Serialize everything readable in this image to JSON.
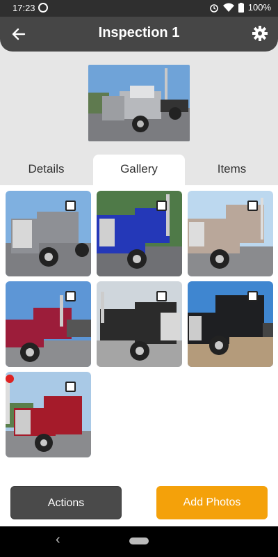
{
  "status": {
    "time": "17:23",
    "battery": "100%"
  },
  "appbar": {
    "title": "Inspection 1",
    "back_icon": "arrow-back-icon",
    "settings_icon": "gear-icon"
  },
  "tabs": [
    {
      "label": "Details",
      "active": false
    },
    {
      "label": "Gallery",
      "active": true
    },
    {
      "label": "Items",
      "active": false
    }
  ],
  "gallery": {
    "photos": [
      {
        "cab_color": "#8e9095",
        "checked": false
      },
      {
        "cab_color": "#2438b8",
        "checked": false
      },
      {
        "cab_color": "#b9a79a",
        "checked": false
      },
      {
        "cab_color": "#9c1d3a",
        "checked": false
      },
      {
        "cab_color": "#2b2b2b",
        "checked": false
      },
      {
        "cab_color": "#1e1f22",
        "checked": false
      },
      {
        "cab_color": "#a51b2a",
        "checked": false
      }
    ]
  },
  "buttons": {
    "actions_label": "Actions",
    "add_photos_label": "Add Photos"
  },
  "colors": {
    "accent": "#f4a10a",
    "appbar": "#464646"
  }
}
